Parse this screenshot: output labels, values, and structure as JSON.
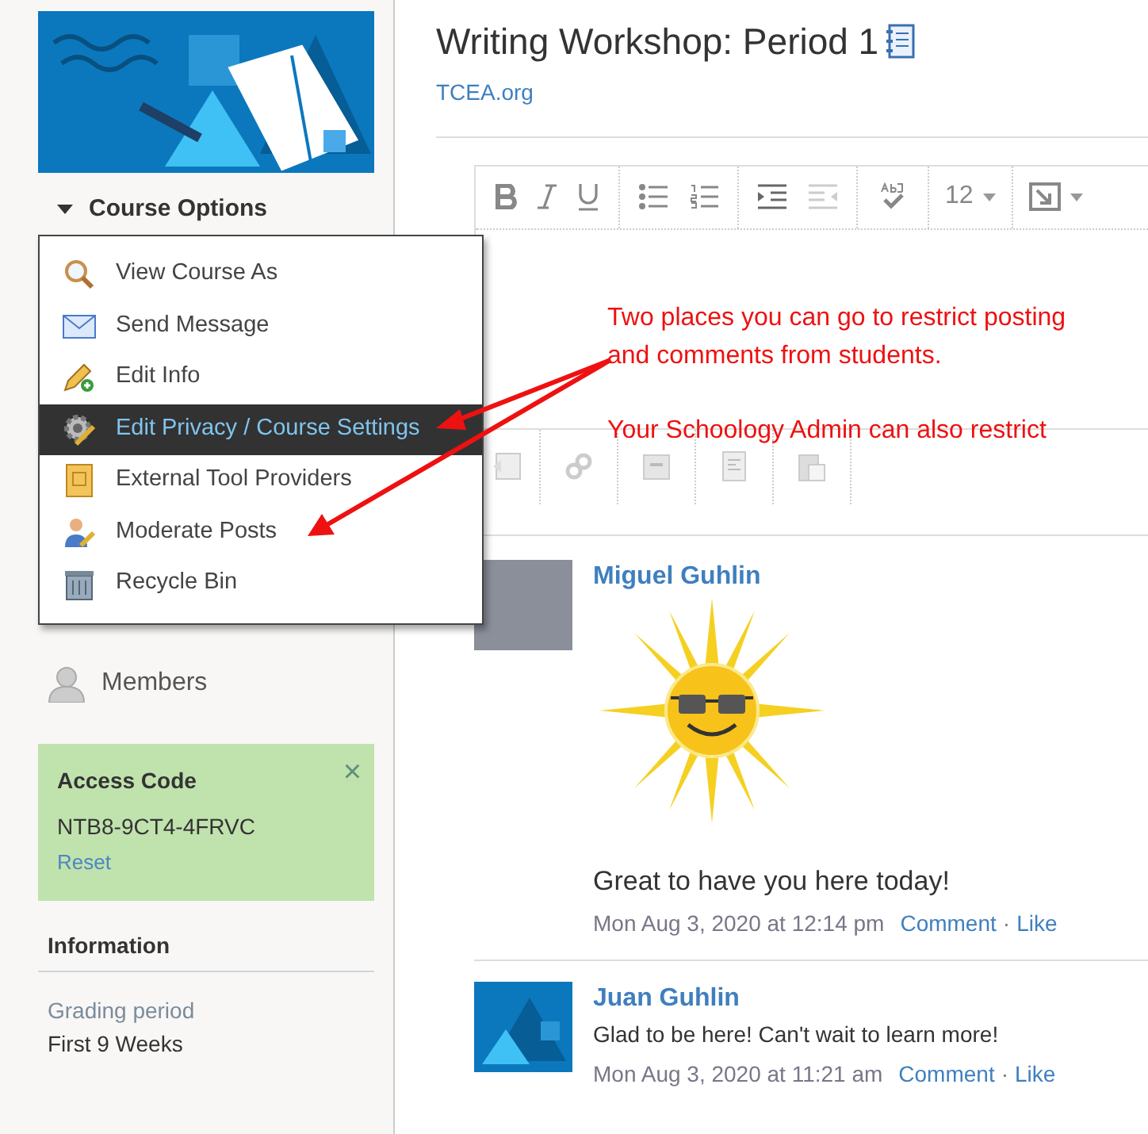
{
  "sidebar": {
    "course_options": {
      "label": "Course Options",
      "expanded": true
    },
    "menu": [
      {
        "label": "View Course As",
        "kind": "magnifier",
        "selected": false
      },
      {
        "label": "Send Message",
        "kind": "envelope",
        "selected": false
      },
      {
        "label": "Edit Info",
        "kind": "pencil",
        "selected": false
      },
      {
        "label": "Edit Privacy / Course Settings",
        "kind": "gear",
        "selected": true
      },
      {
        "label": "External Tool Providers",
        "kind": "tool",
        "selected": false
      },
      {
        "label": "Moderate Posts",
        "kind": "person",
        "selected": false
      },
      {
        "label": "Recycle Bin",
        "kind": "bin",
        "selected": false
      }
    ],
    "nav": [
      {
        "label": "Members"
      }
    ],
    "access_code": {
      "title": "Access Code",
      "code": "NTB8-9CT4-4FRVC",
      "link": "Reset",
      "close": "×"
    },
    "information": {
      "title": "Information",
      "label": "Grading period",
      "value": "First 9 Weeks"
    }
  },
  "main": {
    "title": "Writing Workshop: Period 1",
    "link": "TCEA.org",
    "editor": {
      "font_size": "12"
    },
    "annotation": [
      "Two places you can go to restrict posting and comments from students.",
      "Your Schoology Admin can also restrict"
    ],
    "posts": [
      {
        "author": "Miguel Guhlin",
        "kind": "image",
        "text": "Great to have you here today!",
        "time": "Mon Aug 3, 2020 at 12:14 pm",
        "actions": [
          "Comment",
          "Like"
        ],
        "separator": "·"
      },
      {
        "author": "Juan Guhlin",
        "kind": "text",
        "text": "Glad to be here! Can't wait to learn more!",
        "time": "Mon Aug 3, 2020 at 11:21 am",
        "actions": [
          "Comment",
          "Like"
        ],
        "separator": "·"
      }
    ]
  }
}
